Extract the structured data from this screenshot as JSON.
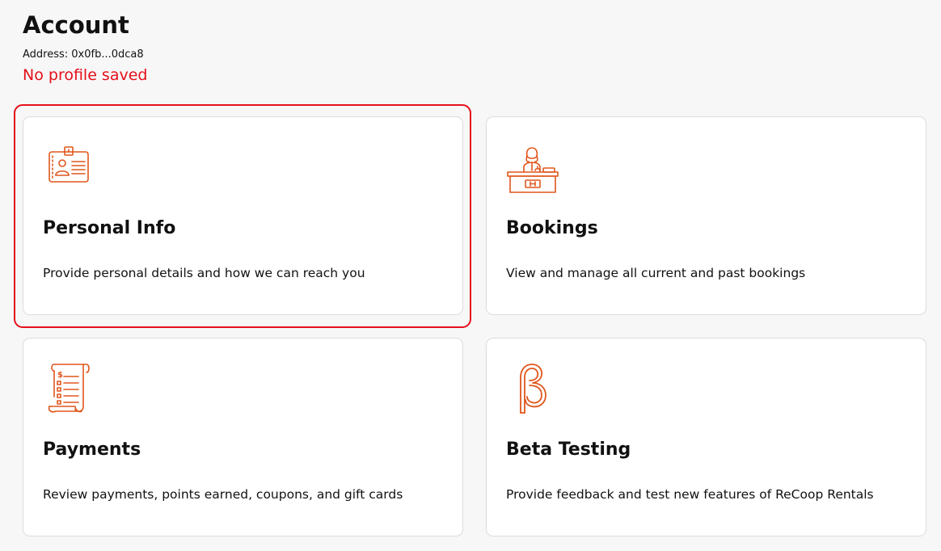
{
  "colors": {
    "accent": "#e0561c",
    "error": "#e5101a",
    "background": "#f7f7f7",
    "card": "#ffffff"
  },
  "header": {
    "title": "Account",
    "address": "Address: 0x0fb...0dca8",
    "profile_status": "No profile saved"
  },
  "cards": [
    {
      "title": "Personal Info",
      "description": "Provide personal details and how we can reach you",
      "icon": "id-card-icon"
    },
    {
      "title": "Bookings",
      "description": "View and manage all current and past bookings",
      "icon": "reception-desk-icon"
    },
    {
      "title": "Payments",
      "description": "Review payments, points earned, coupons, and gift cards",
      "icon": "receipt-icon"
    },
    {
      "title": "Beta Testing",
      "description": "Provide feedback and test new features of ReCoop Rentals",
      "icon": "beta-icon"
    }
  ]
}
